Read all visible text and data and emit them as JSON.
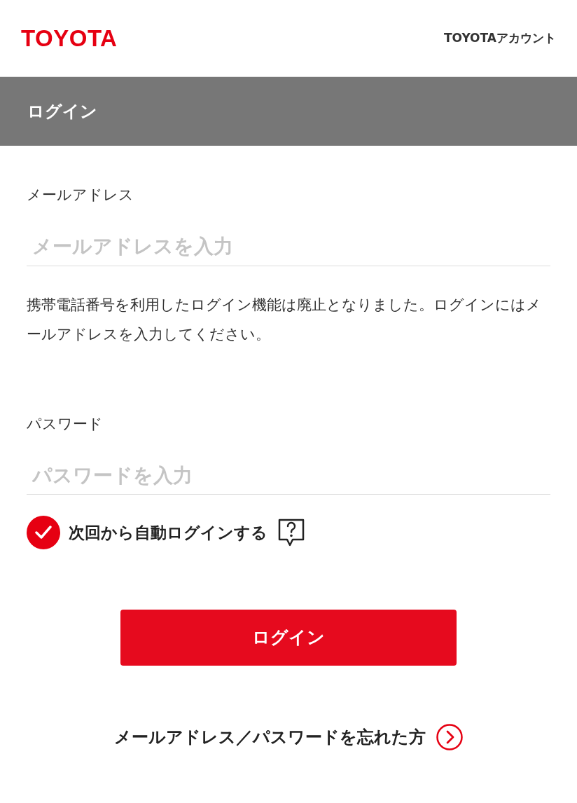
{
  "header": {
    "logo": "TOYOTA",
    "account": "TOYOTAアカウント"
  },
  "title_bar": {
    "title": "ログイン"
  },
  "email": {
    "label": "メールアドレス",
    "placeholder": "メールアドレスを入力"
  },
  "notice": "携帯電話番号を利用したログイン機能は廃止となりました。ログインにはメールアドレスを入力してください。",
  "password": {
    "label": "パスワード",
    "placeholder": "パスワードを入力"
  },
  "auto_login": {
    "label": "次回から自動ログインする",
    "checked": true
  },
  "login_button": "ログイン",
  "forgot_link": "メールアドレス／パスワードを忘れた方"
}
